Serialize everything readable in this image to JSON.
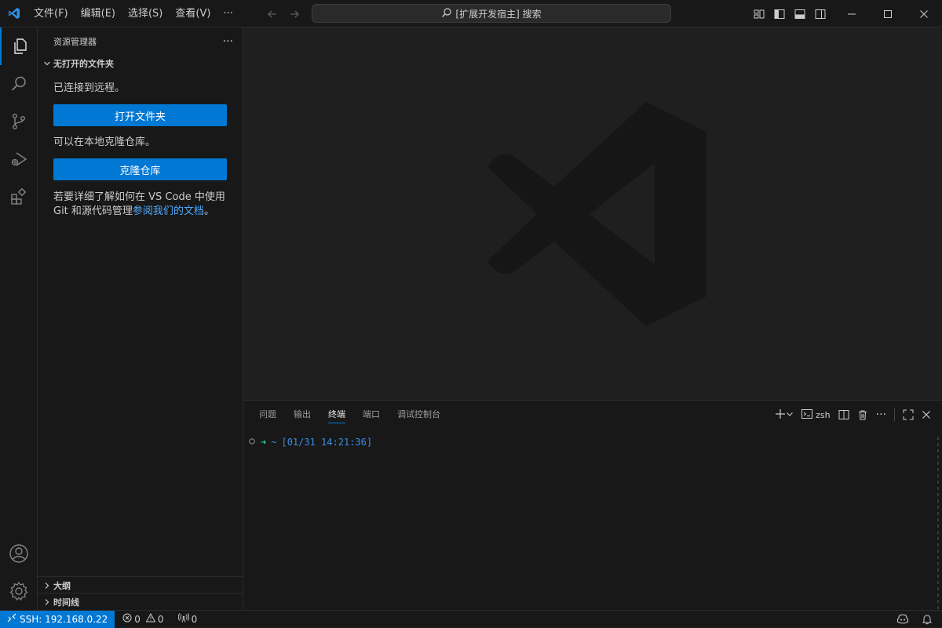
{
  "titlebar": {
    "menus": [
      "文件(F)",
      "编辑(E)",
      "选择(S)",
      "查看(V)",
      "···"
    ],
    "search_text": "[扩展开发宿主] 搜索"
  },
  "sidebar": {
    "title": "资源管理器",
    "more": "···",
    "section_title": "无打开的文件夹",
    "connected_text": "已连接到远程。",
    "open_folder_label": "打开文件夹",
    "clone_hint": "可以在本地克隆仓库。",
    "clone_label": "克隆仓库",
    "learn_text_1": "若要详细了解如何在 VS Code 中使用 Git 和源代码管理",
    "learn_link": "参阅我们的文档",
    "learn_end": "。",
    "outline": "大纲",
    "timeline": "时间线"
  },
  "panel": {
    "tabs": [
      "问题",
      "输出",
      "终端",
      "端口",
      "调试控制台"
    ],
    "active_tab": "终端",
    "shell": "zsh",
    "terminal": {
      "arrow": "➜",
      "cwd": "~",
      "timestamp": "[01/31 14:21:36]"
    }
  },
  "statusbar": {
    "remote": "SSH: 192.168.0.22",
    "errors": "0",
    "warnings": "0",
    "ports": "0"
  },
  "colors": {
    "accent": "#0078d4",
    "link": "#4daafc",
    "prompt_green": "#23d18b",
    "prompt_blue": "#3b8eea"
  }
}
